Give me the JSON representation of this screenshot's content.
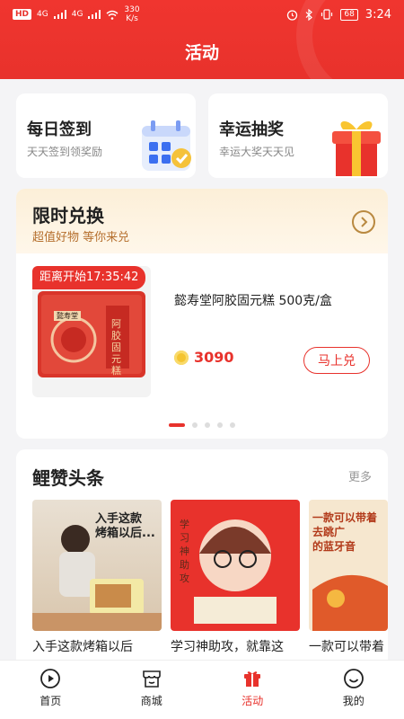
{
  "status_bar": {
    "net_badge": "HD",
    "sig1": "4G",
    "sig2": "4G",
    "speed": "330\nK/s",
    "battery": "68",
    "time": "3:24"
  },
  "header": {
    "title": "活动"
  },
  "quick_actions": [
    {
      "title": "每日签到",
      "subtitle": "天天签到领奖励",
      "icon": "calendar-check-icon"
    },
    {
      "title": "幸运抽奖",
      "subtitle": "幸运大奖天天见",
      "icon": "gift-box-icon"
    }
  ],
  "exchange": {
    "title": "限时兑换",
    "subtitle": "超值好物 等你来兑",
    "countdown": "距离开始17:35:42",
    "product_name": "懿寿堂阿胶固元糕 500克/盒",
    "product_box_text": "阿胶固元糕",
    "product_box_label": "懿寿堂",
    "price": "3090",
    "button": "马上兑",
    "pages": 5,
    "active_page": 1
  },
  "news": {
    "title": "鲤赞头条",
    "more": "更多",
    "items": [
      {
        "caption": "入手这款烤箱以后",
        "thumb_text": "入手这款\n烤箱以后..."
      },
      {
        "caption": "学习神助攻，就靠这",
        "thumb_text": "学习神助攻"
      },
      {
        "caption": "一款可以带着",
        "thumb_text": "一款可以带着\n去跳广\n的蓝牙音"
      }
    ]
  },
  "tabs": [
    {
      "label": "首页",
      "icon": "play-circle-icon",
      "active": false
    },
    {
      "label": "商城",
      "icon": "shop-icon",
      "active": false
    },
    {
      "label": "活动",
      "icon": "gift-icon",
      "active": true
    },
    {
      "label": "我的",
      "icon": "smile-icon",
      "active": false
    }
  ],
  "colors": {
    "brand": "#e8322c",
    "gold": "#b98940"
  }
}
